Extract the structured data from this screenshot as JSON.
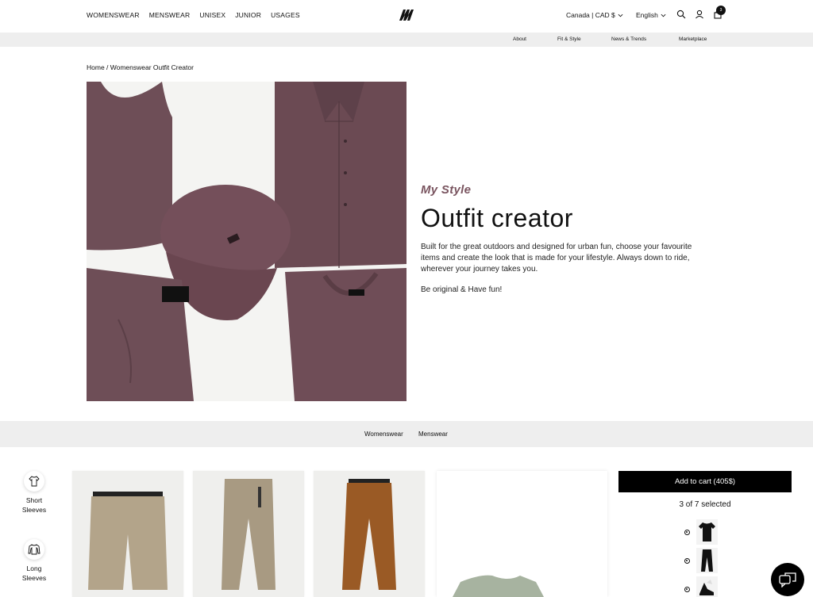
{
  "header": {
    "nav": [
      "WOMENSWEAR",
      "MENSWEAR",
      "UNISEX",
      "JUNIOR",
      "USAGES"
    ],
    "region": "Canada | CAD $",
    "language": "English",
    "cart_count": "3"
  },
  "subnav": [
    "About",
    "Fit & Style",
    "News & Trends",
    "Marketplace"
  ],
  "breadcrumb": "Home / Womenswear Outfit Creator",
  "hero": {
    "kicker": "My Style",
    "title": "Outfit creator",
    "description": "Built for the great outdoors and designed for urban fun, choose your favourite items and create the look that is made for your lifestyle. Always down to ride, wherever your journey takes you.",
    "tagline": "Be original & Have fun!"
  },
  "categories": [
    "Womenswear",
    "Menswear"
  ],
  "filters": [
    {
      "label": "Short Sleeves",
      "icon": "short-sleeve-shirt-icon"
    },
    {
      "label": "Long Sleeves",
      "icon": "long-sleeve-shirt-icon"
    }
  ],
  "cart_panel": {
    "add_label": "Add to cart (405$)",
    "selected": "3 of 7 selected"
  },
  "colors": {
    "accent": "#000000",
    "kicker": "#7a5560",
    "band": "#eeeeee",
    "garment_plum": "#6e4e57"
  }
}
